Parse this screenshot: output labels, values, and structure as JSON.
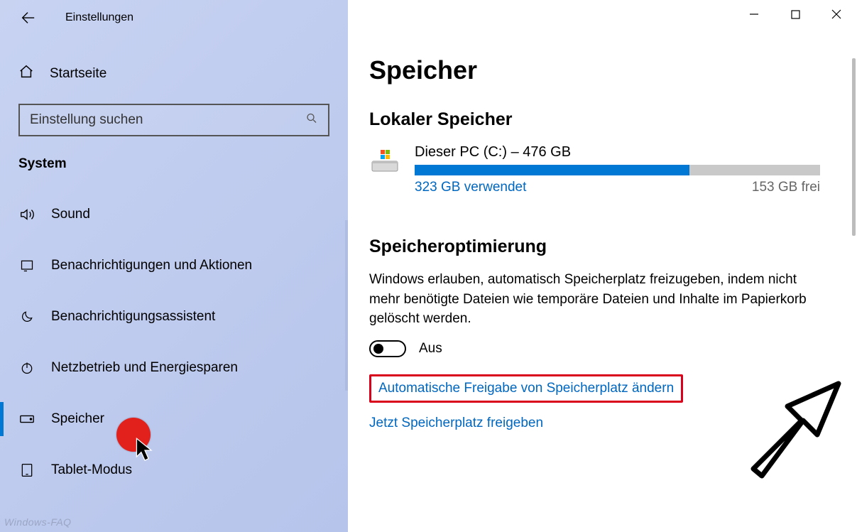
{
  "titlebar": {
    "title": "Einstellungen"
  },
  "sidebar": {
    "home_label": "Startseite",
    "search_placeholder": "Einstellung suchen",
    "heading": "System",
    "items": [
      {
        "label": "Sound"
      },
      {
        "label": "Benachrichtigungen und Aktionen"
      },
      {
        "label": "Benachrichtigungsassistent"
      },
      {
        "label": "Netzbetrieb und Energiesparen"
      },
      {
        "label": "Speicher"
      },
      {
        "label": "Tablet-Modus"
      }
    ]
  },
  "main": {
    "page_title": "Speicher",
    "local_storage_heading": "Lokaler Speicher",
    "drive": {
      "title": "Dieser PC (C:) – 476 GB",
      "used_label": "323 GB verwendet",
      "free_label": "153 GB frei",
      "used_gb": 323,
      "total_gb": 476
    },
    "sense_heading": "Speicheroptimierung",
    "sense_desc": "Windows erlauben, automatisch Speicherplatz freizugeben, indem nicht mehr benötigte Dateien wie temporäre Dateien und Inhalte im Papierkorb gelöscht werden.",
    "toggle_state": "Aus",
    "link_change": "Automatische Freigabe von Speicherplatz ändern",
    "link_now": "Jetzt Speicherplatz freigeben"
  },
  "watermark": "Windows-FAQ"
}
